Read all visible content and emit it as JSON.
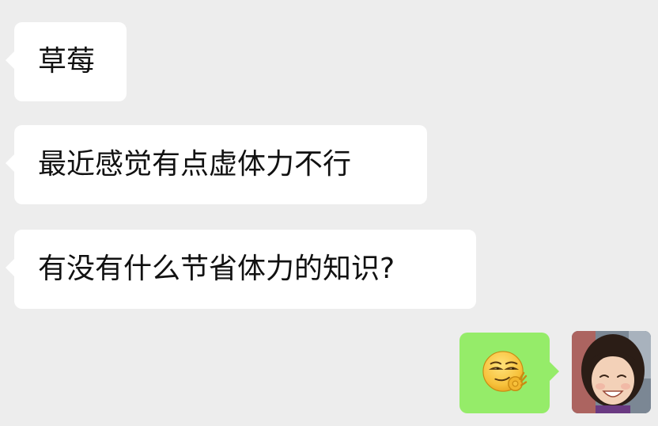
{
  "messages": [
    {
      "text": "草莓"
    },
    {
      "text": "最近感觉有点虚体力不行"
    },
    {
      "text": "有没有什么节省体力的知识?"
    }
  ],
  "reply": {
    "type": "sticker",
    "icon": "smirk-ok-hand-emoji"
  },
  "colors": {
    "background": "#ededed",
    "incoming_bubble": "#ffffff",
    "outgoing_bubble": "#95ec69"
  }
}
